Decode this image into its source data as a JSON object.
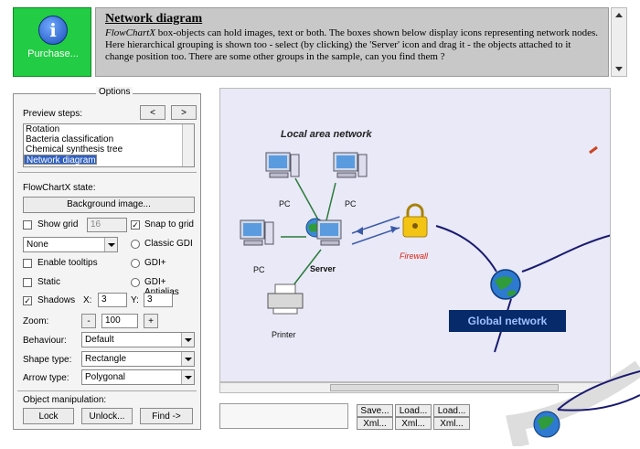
{
  "banner": {
    "purchase_icon": "info-icon",
    "purchase_icon_glyph": "i",
    "purchase_label": "Purchase...",
    "title": "Network diagram",
    "body_product": "FlowChartX",
    "body_text": " box-objects can hold images, text or both. The boxes shown below display icons representing network nodes. Here hierarchical grouping is shown too - select (by clicking) the 'Server' icon and drag it - the objects attached to it change position too. There are some other groups in the sample, can you find them ?"
  },
  "options": {
    "title": "Options",
    "preview_steps_label": "Preview steps:",
    "prev_button": "<",
    "next_button": ">",
    "steps": [
      "Rotation",
      "Bacteria classification",
      "Chemical synthesis tree",
      "Network diagram"
    ],
    "selected_step": "Network diagram",
    "state_label": "FlowChartX state:",
    "background_button": "Background image...",
    "show_grid_label": "Show grid",
    "show_grid_checked": false,
    "grid_size": "16",
    "snap_to_grid_label": "Snap to grid",
    "snap_to_grid_checked": true,
    "grid_style_value": "None",
    "classic_gdi_label": "Classic GDI",
    "enable_tooltips_label": "Enable tooltips",
    "enable_tooltips_checked": false,
    "gdi_plus_label": "GDI+",
    "static_label": "Static",
    "static_checked": false,
    "gdi_antialias_label": "GDI+ Antialias",
    "shadows_label": "Shadows",
    "shadows_checked": true,
    "shadow_x_label": "X:",
    "shadow_x": "3",
    "shadow_y_label": "Y:",
    "shadow_y": "3",
    "zoom_label": "Zoom:",
    "zoom_minus": "-",
    "zoom_value": "100",
    "zoom_plus": "+",
    "behaviour_label": "Behaviour:",
    "behaviour_value": "Default",
    "shape_type_label": "Shape type:",
    "shape_type_value": "Rectangle",
    "arrow_type_label": "Arrow type:",
    "arrow_type_value": "Polygonal",
    "manipulation_label": "Object manipulation:",
    "lock_button": "Lock",
    "unlock_button": "Unlock...",
    "find_button": "Find ->"
  },
  "diagram": {
    "lan_title": "Local area network",
    "pc_label": "PC",
    "server_label": "Server",
    "printer_label": "Printer",
    "firewall_label": "Firewall",
    "global_label": "Global network"
  },
  "file_buttons": {
    "save": "Save...",
    "load": "Load...",
    "xml": "Xml..."
  },
  "colors": {
    "purchase_bg": "#22cc44",
    "canvas_bg": "#e9e9f7",
    "global_box": "#062a6a",
    "firewall_text": "#dd2211"
  }
}
